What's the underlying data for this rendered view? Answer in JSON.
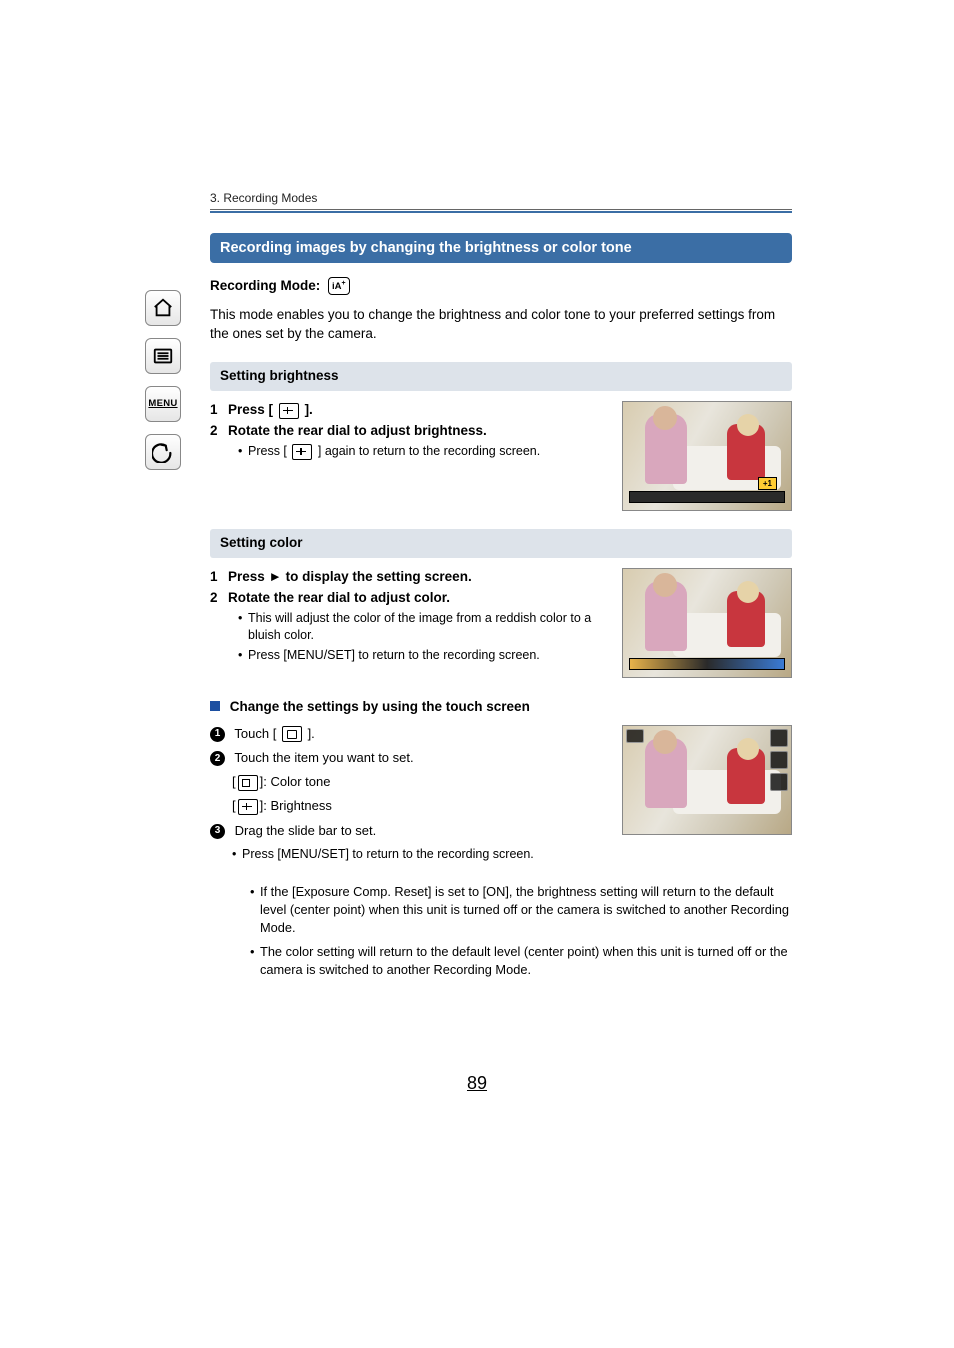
{
  "chapter": "3. Recording Modes",
  "heading": "Recording images by changing the brightness or color tone",
  "recMode": {
    "label": "Recording Mode:",
    "icon": "iA+"
  },
  "intro": "This mode enables you to change the brightness and color tone to your preferred settings from the ones set by the camera.",
  "brightness": {
    "title": "Setting brightness",
    "s1a": "Press [",
    "s1b": "].",
    "s2": "Rotate the rear dial to adjust brightness.",
    "s2sub_a": "Press [",
    "s2sub_b": "] again to return to the recording screen.",
    "badge": "+1"
  },
  "color": {
    "title": "Setting color",
    "s1": "Press ► to display the setting screen.",
    "s2": "Rotate the rear dial to adjust color.",
    "sub1": "This will adjust the color of the image from a reddish color to a bluish color.",
    "sub2": "Press [MENU/SET] to return to the recording screen."
  },
  "touch": {
    "title": "Change the settings by using the touch screen",
    "t1a": "Touch [",
    "t1b": "].",
    "t2": "Touch the item you want to set.",
    "opt1": "]: Color tone",
    "opt2": "]: Brightness",
    "t3": "Drag the slide bar to set.",
    "t3sub": "Press [MENU/SET] to return to the recording screen."
  },
  "notes": {
    "n1": "If the [Exposure Comp. Reset] is set to [ON], the brightness setting will return to the default level (center point) when this unit is turned off or the camera is switched to another Recording Mode.",
    "n2": "The color setting will return to the default level (center point) when this unit is turned off or the camera is switched to another Recording Mode."
  },
  "page": "89",
  "nav": {
    "menu": "MENU"
  }
}
